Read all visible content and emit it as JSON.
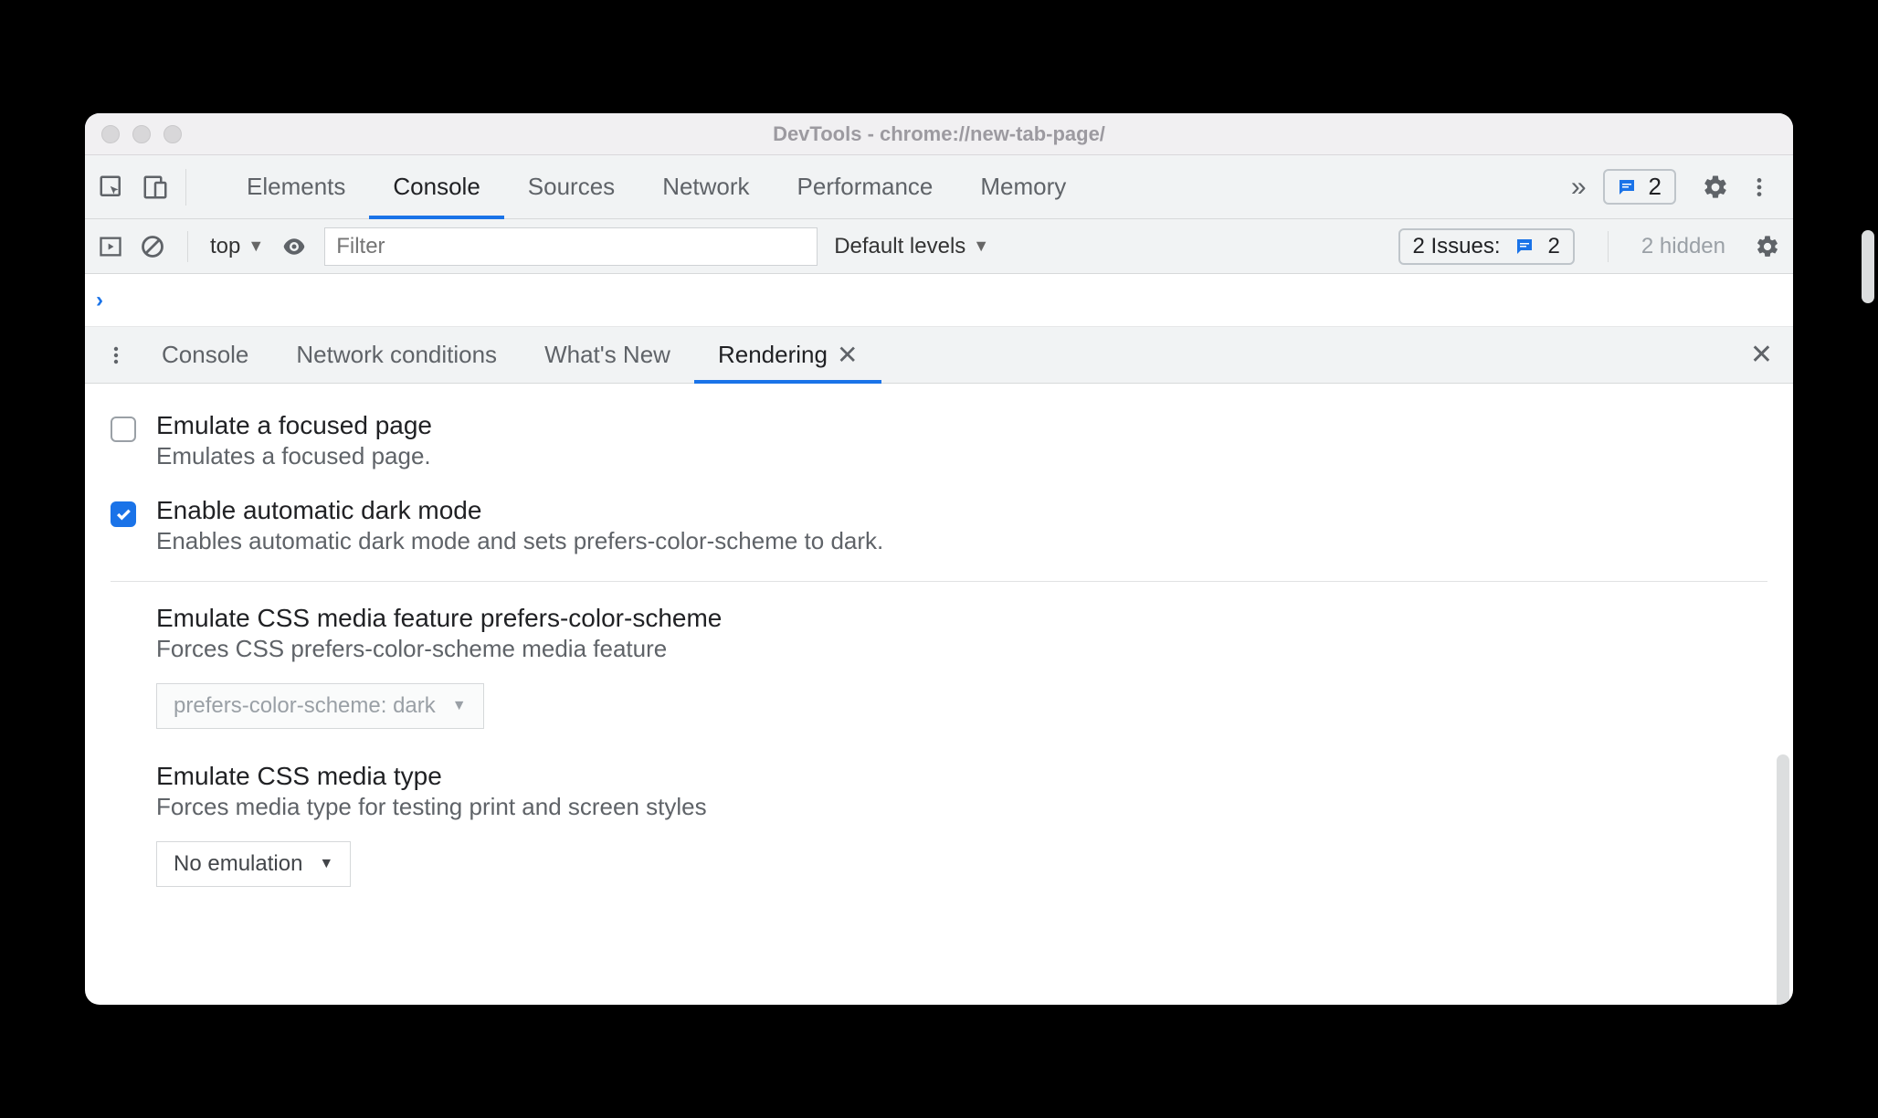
{
  "window_title": "DevTools - chrome://new-tab-page/",
  "main_tabs": {
    "elements": "Elements",
    "console": "Console",
    "sources": "Sources",
    "network": "Network",
    "performance": "Performance",
    "memory": "Memory"
  },
  "main_badge_count": "2",
  "console_bar": {
    "context": "top",
    "filter_placeholder": "Filter",
    "levels": "Default levels",
    "issues_label": "2 Issues:",
    "issues_count": "2",
    "hidden": "2 hidden"
  },
  "drawer_tabs": {
    "console": "Console",
    "network_conditions": "Network conditions",
    "whats_new": "What's New",
    "rendering": "Rendering"
  },
  "options": {
    "focused": {
      "title": "Emulate a focused page",
      "desc": "Emulates a focused page."
    },
    "darkmode": {
      "title": "Enable automatic dark mode",
      "desc": "Enables automatic dark mode and sets prefers-color-scheme to dark."
    }
  },
  "settings": {
    "prefers": {
      "title": "Emulate CSS media feature prefers-color-scheme",
      "desc": "Forces CSS prefers-color-scheme media feature",
      "value": "prefers-color-scheme: dark"
    },
    "media_type": {
      "title": "Emulate CSS media type",
      "desc": "Forces media type for testing print and screen styles",
      "value": "No emulation"
    }
  }
}
